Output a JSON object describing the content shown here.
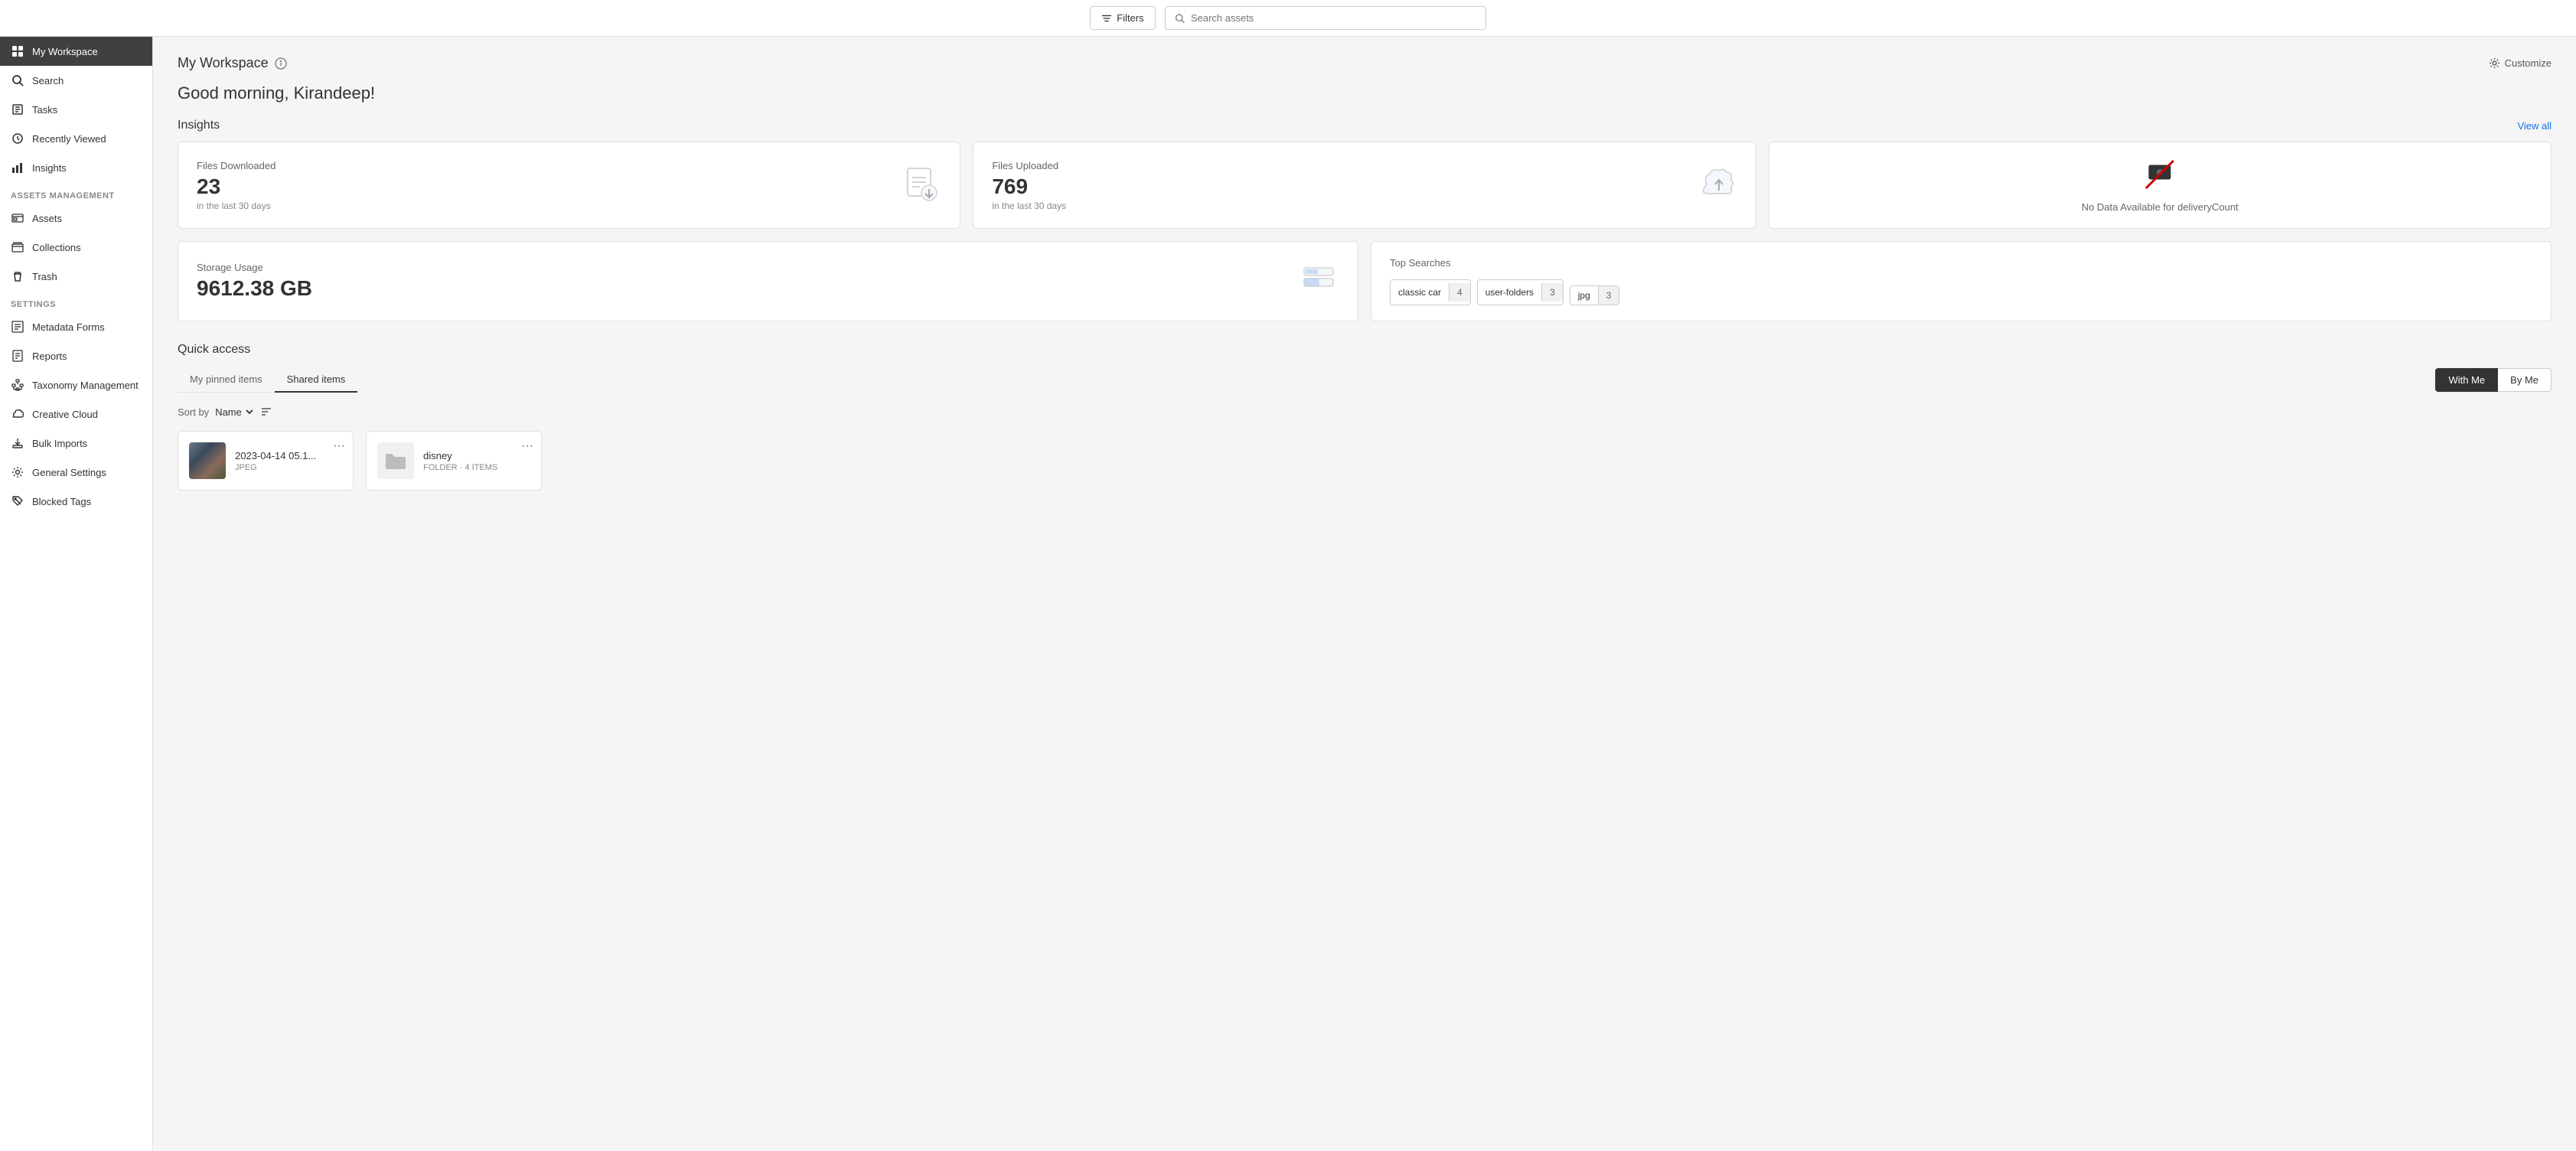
{
  "topbar": {
    "filters_label": "Filters",
    "search_placeholder": "Search assets"
  },
  "sidebar": {
    "active_item": "my-workspace",
    "top_items": [
      {
        "id": "my-workspace",
        "label": "My Workspace",
        "icon": "grid"
      },
      {
        "id": "search",
        "label": "Search",
        "icon": "search"
      },
      {
        "id": "tasks",
        "label": "Tasks",
        "icon": "tasks"
      },
      {
        "id": "recently-viewed",
        "label": "Recently Viewed",
        "icon": "clock"
      },
      {
        "id": "insights",
        "label": "Insights",
        "icon": "bar-chart"
      }
    ],
    "assets_management_label": "Assets Management",
    "assets_items": [
      {
        "id": "assets",
        "label": "Assets",
        "icon": "assets"
      },
      {
        "id": "collections",
        "label": "Collections",
        "icon": "collections"
      },
      {
        "id": "trash",
        "label": "Trash",
        "icon": "trash"
      }
    ],
    "settings_label": "Settings",
    "settings_items": [
      {
        "id": "metadata-forms",
        "label": "Metadata Forms",
        "icon": "metadata"
      },
      {
        "id": "reports",
        "label": "Reports",
        "icon": "reports"
      },
      {
        "id": "taxonomy-management",
        "label": "Taxonomy Management",
        "icon": "taxonomy"
      },
      {
        "id": "creative-cloud",
        "label": "Creative Cloud",
        "icon": "creative-cloud"
      },
      {
        "id": "bulk-imports",
        "label": "Bulk Imports",
        "icon": "bulk-imports"
      },
      {
        "id": "general-settings",
        "label": "General Settings",
        "icon": "settings"
      },
      {
        "id": "blocked-tags",
        "label": "Blocked Tags",
        "icon": "blocked-tags"
      }
    ]
  },
  "main": {
    "page_title": "My Workspace",
    "customize_label": "Customize",
    "greeting": "Good morning, Kirandeep!",
    "insights": {
      "section_title": "Insights",
      "view_all_label": "View all",
      "cards": [
        {
          "id": "files-downloaded",
          "label": "Files Downloaded",
          "value": "23",
          "sublabel": "in the last 30 days",
          "icon": "download"
        },
        {
          "id": "files-uploaded",
          "label": "Files Uploaded",
          "value": "769",
          "sublabel": "in the last 30 days",
          "icon": "upload"
        },
        {
          "id": "delivery-count",
          "label": "",
          "value": "",
          "no_data_text": "No Data Available for deliveryCount",
          "icon": "delivery"
        }
      ],
      "storage_card": {
        "label": "Storage Usage",
        "value": "9612.38 GB",
        "icon": "storage"
      },
      "top_searches": {
        "label": "Top Searches",
        "tags": [
          {
            "name": "classic car",
            "count": "4"
          },
          {
            "name": "user-folders",
            "count": "3"
          },
          {
            "name": "jpg",
            "count": "3"
          }
        ]
      }
    },
    "quick_access": {
      "title": "Quick access",
      "tabs": [
        {
          "id": "my-pinned",
          "label": "My pinned items"
        },
        {
          "id": "shared",
          "label": "Shared items",
          "active": true
        }
      ],
      "view_buttons": [
        {
          "id": "with-me",
          "label": "With Me",
          "active": true
        },
        {
          "id": "by-me",
          "label": "By Me",
          "active": false
        }
      ],
      "sort_label": "Sort by",
      "sort_value": "Name",
      "files": [
        {
          "id": "file-1",
          "name": "2023-04-14 05.1...",
          "type": "JPEG",
          "has_thumb": true
        },
        {
          "id": "file-2",
          "name": "disney",
          "type": "FOLDER · 4 ITEMS",
          "has_thumb": false,
          "is_folder": true
        }
      ]
    }
  }
}
